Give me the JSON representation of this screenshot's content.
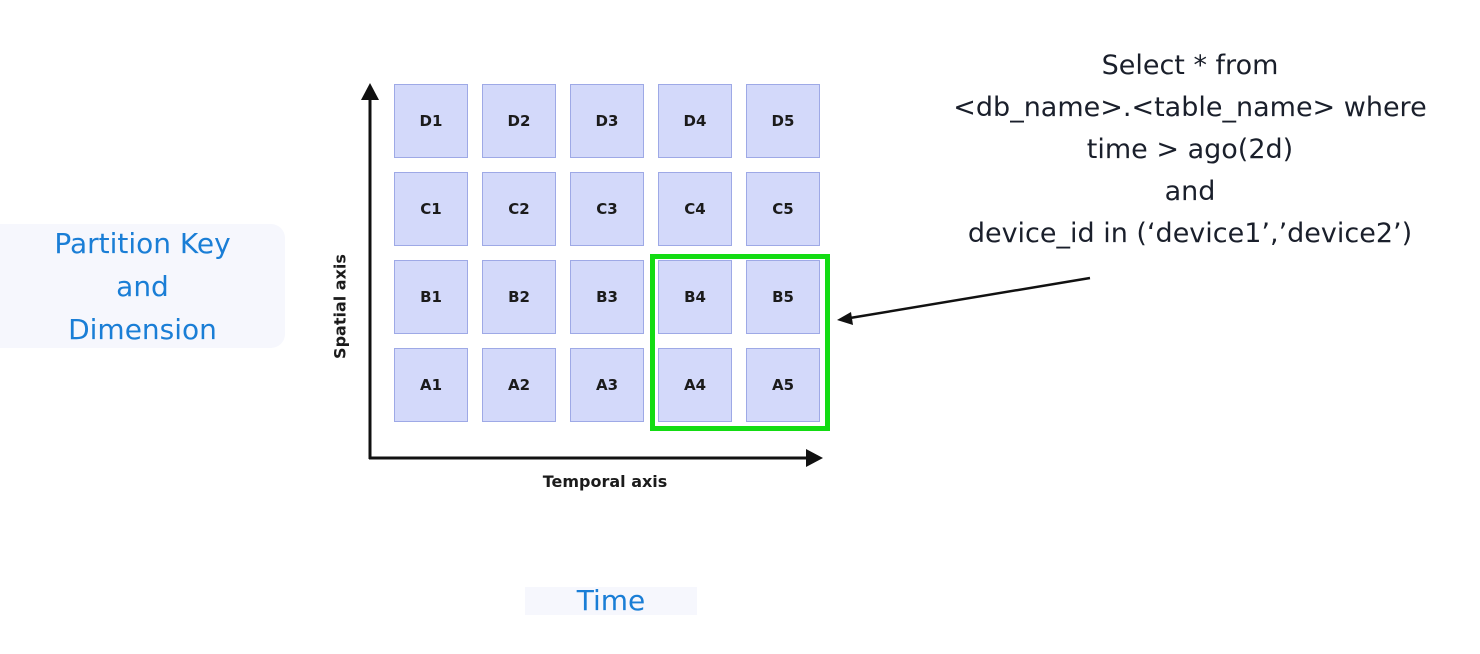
{
  "side_label": {
    "lines": [
      "Partition Key",
      "and",
      "Dimension"
    ],
    "color": "#1a7ed6"
  },
  "bottom_label": {
    "text": "Time",
    "color": "#1a7ed6"
  },
  "grid": {
    "rows": [
      {
        "name": "D",
        "cells": [
          "D1",
          "D2",
          "D3",
          "D4",
          "D5"
        ]
      },
      {
        "name": "C",
        "cells": [
          "C1",
          "C2",
          "C3",
          "C4",
          "C5"
        ]
      },
      {
        "name": "B",
        "cells": [
          "B1",
          "B2",
          "B3",
          "B4",
          "B5"
        ]
      },
      {
        "name": "A",
        "cells": [
          "A1",
          "A2",
          "A3",
          "A4",
          "A5"
        ]
      }
    ],
    "cell_fill": "#d3d9fa",
    "cell_border": "#9ea9e6",
    "highlighted_cells": [
      "B4",
      "B5",
      "A4",
      "A5"
    ],
    "highlight_color": "#13dc13"
  },
  "axes": {
    "x_label": "Temporal axis",
    "y_label": "Spatial axis"
  },
  "query": {
    "lines": [
      "Select * from",
      "<db_name>.<table_name> where",
      "time > ago(2d)",
      "and",
      "device_id in (‘device1’,’device2’)"
    ]
  },
  "annotation_arrow": {
    "from": "query",
    "to": "highlighted_cells"
  }
}
